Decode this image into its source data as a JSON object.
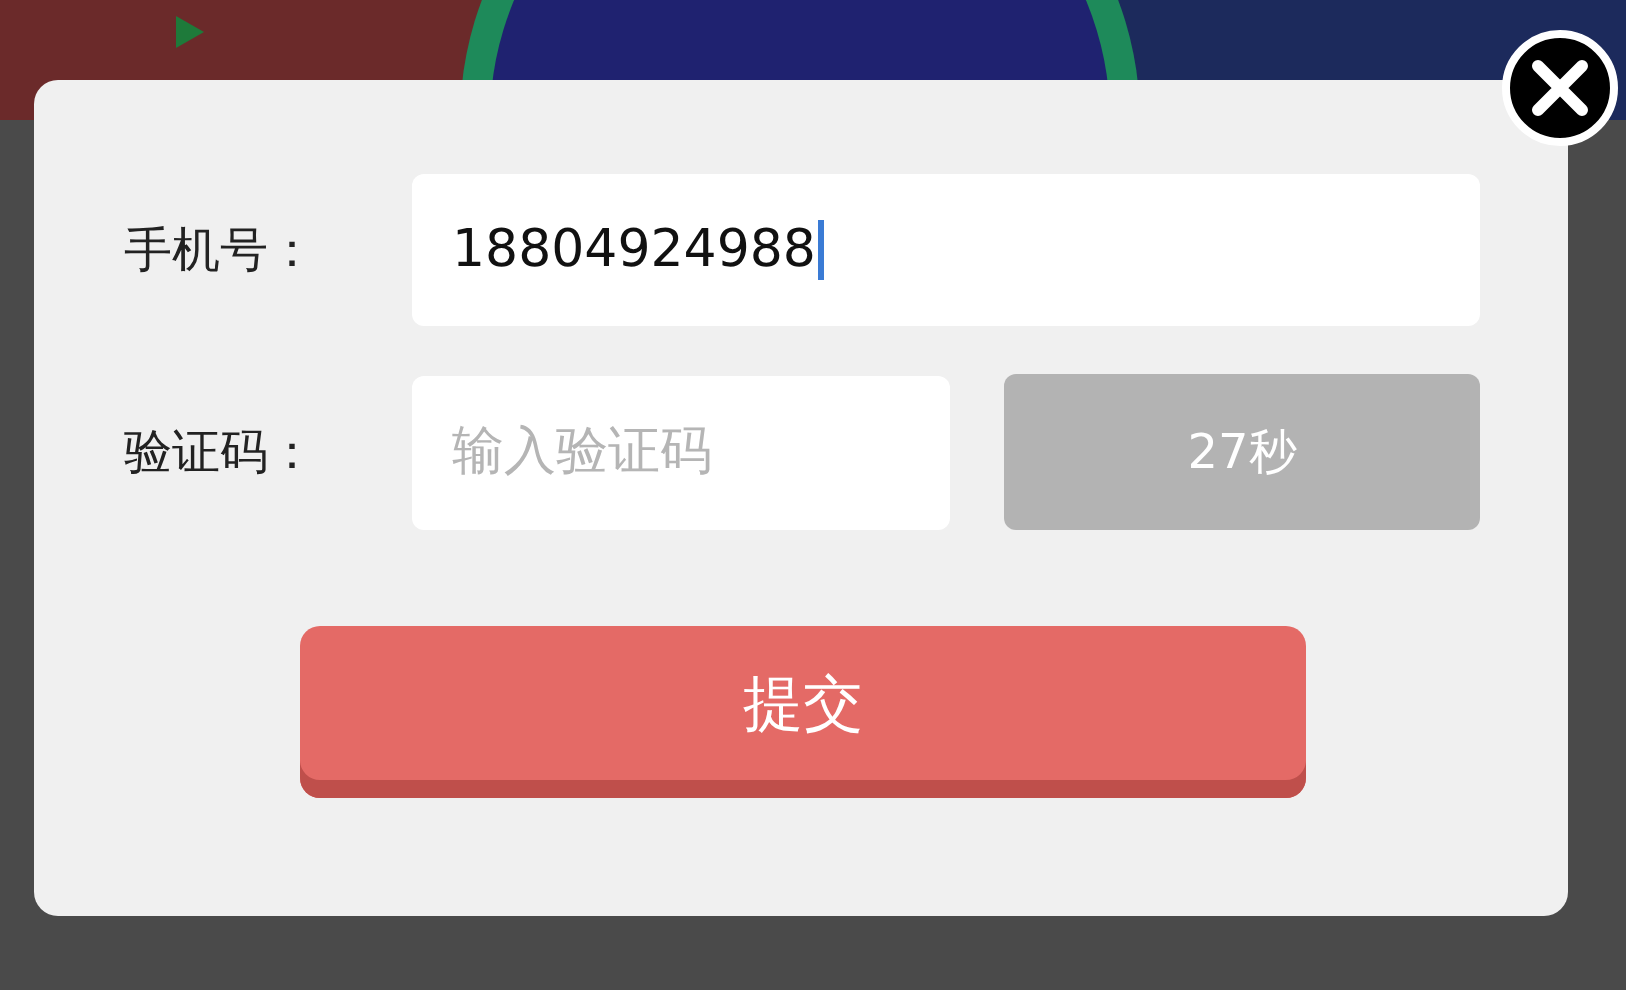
{
  "form": {
    "phone": {
      "label": "手机号：",
      "value": "18804924988",
      "focused": true
    },
    "code": {
      "label": "验证码：",
      "placeholder": "输入验证码",
      "focused": false
    },
    "code_button": {
      "label": "27秒",
      "disabled": true
    },
    "submit_button": {
      "label": "提交"
    }
  }
}
